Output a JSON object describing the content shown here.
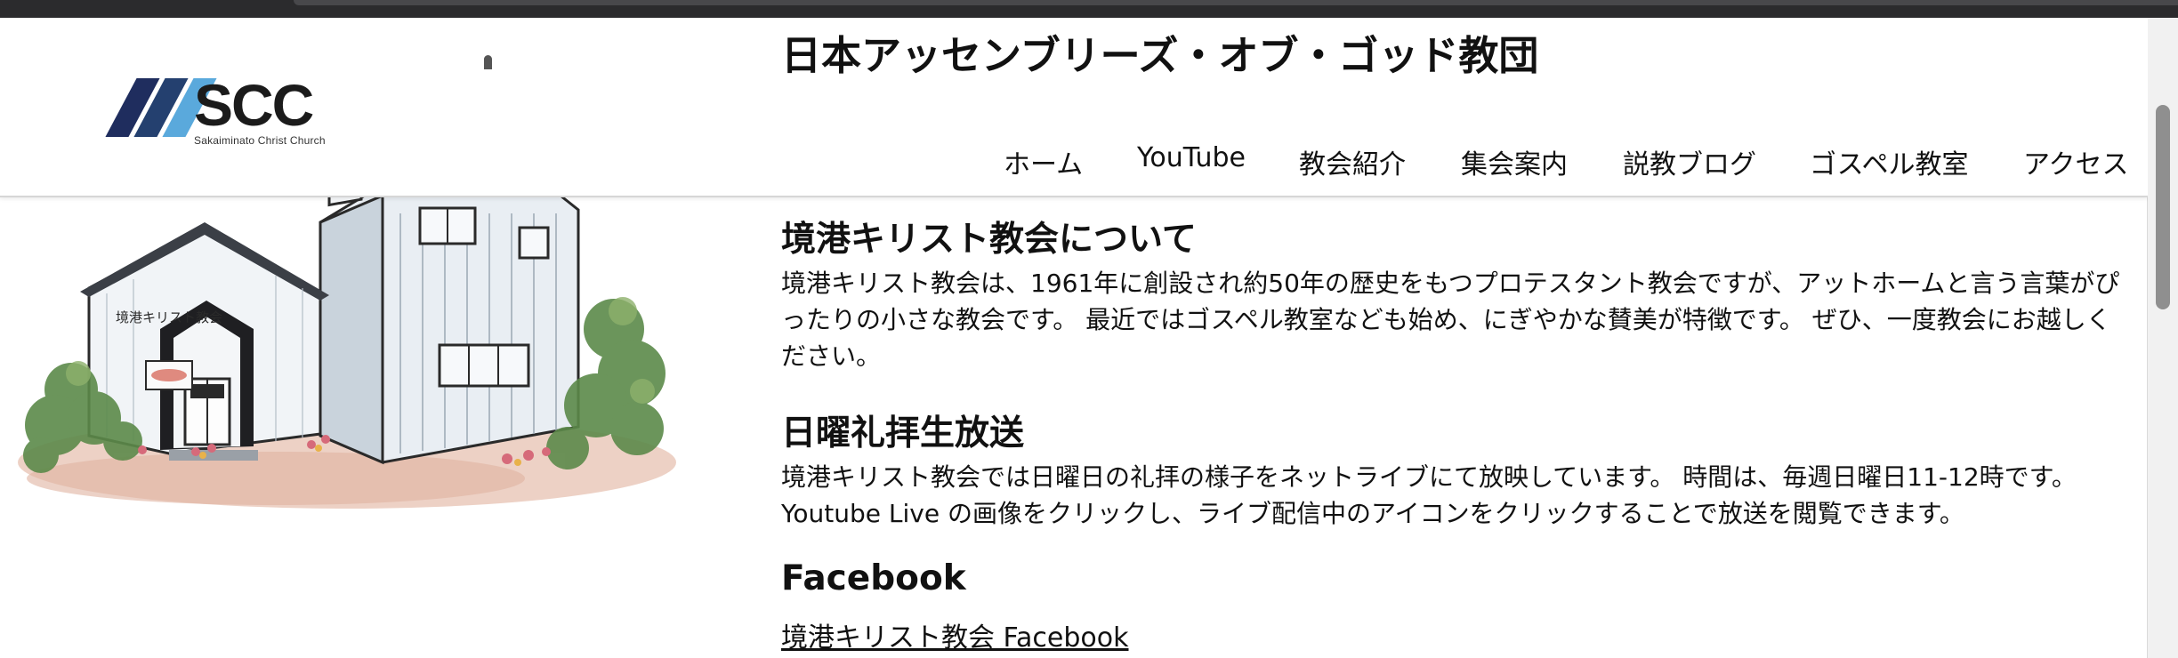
{
  "header": {
    "logo_word": "SCC",
    "logo_tagline": "Sakaiminato Christ Church",
    "site_title": "日本アッセンブリーズ・オブ・ゴッド教団"
  },
  "nav": {
    "items": [
      "ホーム",
      "YouTube",
      "教会紹介",
      "集会案内",
      "説教ブログ",
      "ゴスペル教室",
      "アクセス"
    ]
  },
  "illustration": {
    "sign_text": "境港キリスト教会"
  },
  "sections": {
    "about": {
      "heading": "境港キリスト教会について",
      "body": "境港キリスト教会は、1961年に創設され約50年の歴史をもつプロテスタント教会ですが、アットホームと言う言葉がぴったりの小さな教会です。 最近ではゴスペル教室なども始め、にぎやかな賛美が特徴です。 ぜひ、一度教会にお越しください。"
    },
    "broadcast": {
      "heading": "日曜礼拝生放送",
      "body": "境港キリスト教会では日曜日の礼拝の様子をネットライブにて放映しています。 時間は、毎週日曜日11-12時です。 Youtube Live の画像をクリックし、ライブ配信中のアイコンをクリックすることで放送を閲覧できます。"
    },
    "facebook": {
      "heading": "Facebook",
      "link": "境港キリスト教会 Facebook"
    }
  },
  "colors": {
    "logo_navy": "#1f2d5e",
    "logo_blue": "#24406f",
    "logo_sky": "#5aa9dc",
    "page_bg": "#ffffff",
    "browser_chrome": "#2b2b2d"
  }
}
